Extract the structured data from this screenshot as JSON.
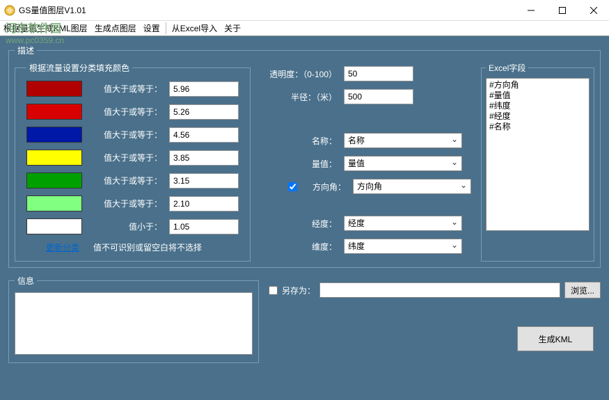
{
  "window": {
    "title": "GS量值图层V1.01"
  },
  "menu": {
    "items": [
      "根据量值生成KML图层",
      "生成点图层",
      "设置",
      "从Excel导入",
      "关于"
    ]
  },
  "watermark": {
    "line1": "河东软件园",
    "line2": "www.pc0359.cn"
  },
  "desc": {
    "legend": "描述",
    "colorsLegend": "根据流量设置分类填充颜色",
    "rows": [
      {
        "color": "#b10000",
        "label": "值大于或等于：",
        "value": "5.96"
      },
      {
        "color": "#d80000",
        "label": "值大于或等于：",
        "value": "5.26"
      },
      {
        "color": "#0018a8",
        "label": "值大于或等于：",
        "value": "4.56"
      },
      {
        "color": "#ffff00",
        "label": "值大于或等于：",
        "value": "3.85"
      },
      {
        "color": "#00a000",
        "label": "值大于或等于：",
        "value": "3.15"
      },
      {
        "color": "#80ff80",
        "label": "值大于或等于：",
        "value": "2.10"
      },
      {
        "color": "#ffffff",
        "label": "值小于：",
        "value": "1.05"
      }
    ],
    "updateLink": "更新分类",
    "updateNote": "值不可识别或留空白将不选择"
  },
  "mid": {
    "opacityLabel": "透明度：（0-100）",
    "opacityValue": "50",
    "radiusLabel": "半径：（米）",
    "radiusValue": "500",
    "nameLabel": "名称：",
    "nameValue": "名称",
    "valueLabel": "量值：",
    "valueValue": "量值",
    "angleLabel": "方向角：",
    "angleValue": "方向角",
    "lngLabel": "经度：",
    "lngValue": "经度",
    "latLabel": "维度：",
    "latValue": "纬度"
  },
  "excel": {
    "legend": "Excel字段",
    "items": [
      "#方向角",
      "#量值",
      "#纬度",
      "#经度",
      "#名称"
    ]
  },
  "info": {
    "legend": "信息",
    "text": ""
  },
  "saveas": {
    "label": "另存为：",
    "value": "",
    "browse": "浏览..."
  },
  "generate": "生成KML"
}
